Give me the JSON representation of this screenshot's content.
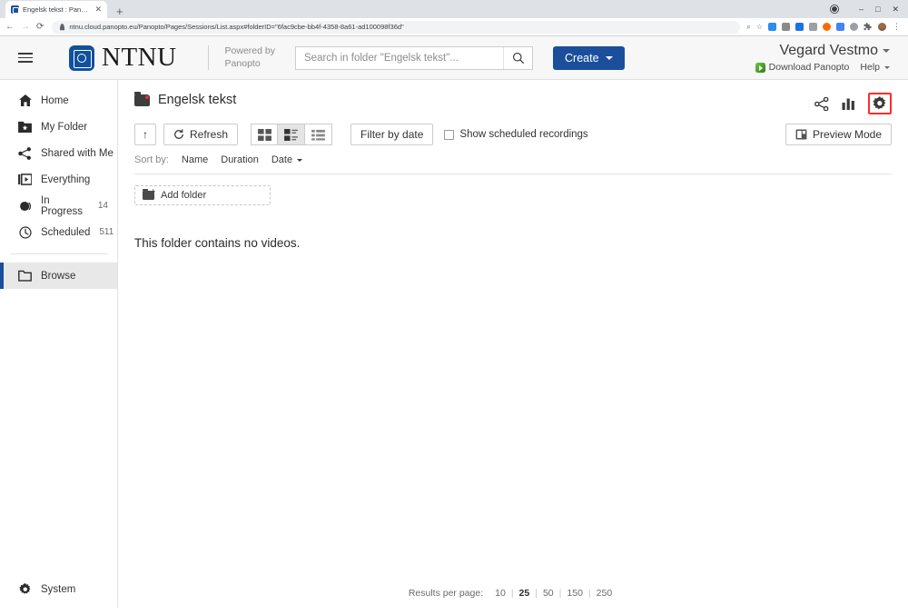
{
  "browser": {
    "tab_title": "Engelsk tekst : Panopto",
    "tab_close": "✕",
    "new_tab": "+",
    "back": "←",
    "forward": "→",
    "reload": "⟳",
    "lock": "🔒",
    "url": "ntnu.cloud.panopto.eu/Panopto/Pages/Sessions/List.aspx#folderID=\"6fac9cbe-bb4f-4358-8a61-ad100098f36d\"",
    "zoom_icon": "⌕",
    "bookmark_icon": "☆",
    "kebab_icon": "⋮",
    "window_minimize": "–",
    "window_maximize": "□",
    "window_close": "✕",
    "extension_colors": [
      "#2d8cf0",
      "#8a8a8a",
      "#1a73e8",
      "#9aa0a6",
      "#ff6a00",
      "#4285f4",
      "#8a8a8a",
      "#5f6368"
    ]
  },
  "header": {
    "menu_icon": "hamburger",
    "brand_text": "NTNU",
    "powered_line1": "Powered by",
    "powered_line2": "Panopto",
    "search_placeholder": "Search in folder \"Engelsk tekst\"...",
    "search_value": "",
    "create_label": "Create",
    "user_name": "Vegard Vestmo",
    "download_label": "Download Panopto",
    "help_label": "Help"
  },
  "sidebar": {
    "items": [
      {
        "label": "Home",
        "icon": "home-icon",
        "count": ""
      },
      {
        "label": "My Folder",
        "icon": "folder-star-icon",
        "count": ""
      },
      {
        "label": "Shared with Me",
        "icon": "share-icon",
        "count": ""
      },
      {
        "label": "Everything",
        "icon": "video-library-icon",
        "count": ""
      },
      {
        "label": "In Progress",
        "icon": "progress-icon",
        "count": "14"
      },
      {
        "label": "Scheduled",
        "icon": "clock-icon",
        "count": "511"
      },
      {
        "label": "Browse",
        "icon": "folder-icon",
        "count": ""
      }
    ],
    "system_label": "System"
  },
  "main": {
    "folder_title": "Engelsk tekst",
    "share_icon": "share-icon",
    "stats_icon": "bar-chart-icon",
    "settings_icon": "gear-icon",
    "preview_mode_label": "Preview Mode",
    "toolbar": {
      "up_label": "↑",
      "refresh_label": "Refresh",
      "view_grid": "grid-view",
      "view_list_thumbs": "list-thumbnail-view",
      "view_compact": "compact-list-view",
      "filter_by_date_label": "Filter by date",
      "show_scheduled_label": "Show scheduled recordings",
      "show_scheduled_checked": false
    },
    "sort": {
      "label": "Sort by:",
      "options": [
        "Name",
        "Duration",
        "Date"
      ],
      "active": "Date"
    },
    "add_folder_label": "Add folder",
    "empty_message": "This folder contains no videos.",
    "footer": {
      "results_label": "Results per page:",
      "options": [
        "10",
        "25",
        "50",
        "150",
        "250"
      ],
      "active": "25",
      "divider": "|"
    }
  },
  "colors": {
    "brand_blue": "#11509e",
    "create_blue": "#1b4f9c",
    "highlight_red": "#ff2b2b",
    "folder_dot_red": "#e03030"
  }
}
